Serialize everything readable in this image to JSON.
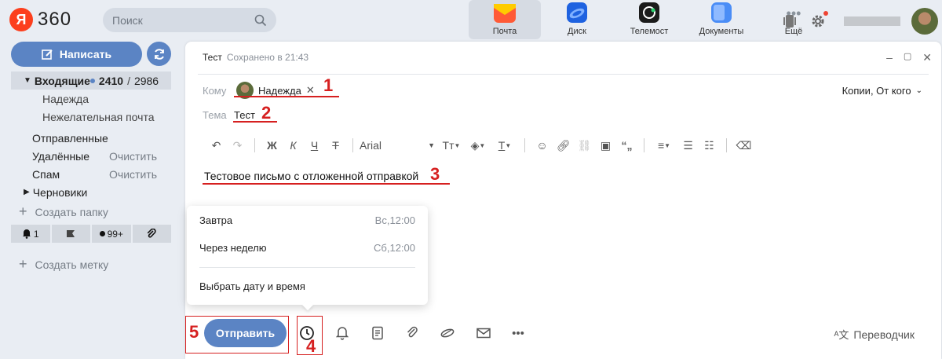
{
  "logo": {
    "badge": "Я",
    "text": "360"
  },
  "search": {
    "placeholder": "Поиск"
  },
  "apps": [
    {
      "label": "Почта",
      "icon": "mail-icon",
      "active": true
    },
    {
      "label": "Диск",
      "icon": "disk-icon"
    },
    {
      "label": "Телемост",
      "icon": "telemost-icon"
    },
    {
      "label": "Документы",
      "icon": "documents-icon"
    },
    {
      "label": "Ещё",
      "icon": "more-icon"
    }
  ],
  "sidebar": {
    "compose_label": "Написать",
    "folders": {
      "inbox": {
        "label": "Входящие",
        "unread": "2410",
        "total": "2986"
      },
      "nadezhda": {
        "label": "Надежда"
      },
      "spam_sub": {
        "label": "Нежелательная почта"
      },
      "sent": {
        "label": "Отправленные"
      },
      "deleted": {
        "label": "Удалённые",
        "action": "Очистить"
      },
      "spam": {
        "label": "Спам",
        "action": "Очистить"
      },
      "drafts": {
        "label": "Черновики"
      }
    },
    "create_folder": "Создать папку",
    "filters": {
      "reminders": "1",
      "unread": "99+"
    },
    "create_label": "Создать метку"
  },
  "compose": {
    "subject_title": "Тест",
    "saved_status": "Сохранено в 21:43",
    "to_label": "Кому",
    "recipient": "Надежда",
    "copies_label": "Копии, От кого",
    "subject_label": "Тема",
    "subject_value": "Тест",
    "font": "Arial",
    "body": "Тестовое письмо с отложенной отправкой",
    "send_label": "Отправить",
    "translator_label": "Переводчик"
  },
  "schedule_menu": {
    "options": [
      {
        "label": "Завтра",
        "time": "Вс,12:00"
      },
      {
        "label": "Через неделю",
        "time": "Сб,12:00"
      }
    ],
    "custom_label": "Выбрать дату и время"
  },
  "annotations": [
    "1",
    "2",
    "3",
    "4",
    "5"
  ],
  "colors": {
    "accent": "#5b84c4",
    "annotation": "#d62020",
    "background": "#e9edf3"
  }
}
